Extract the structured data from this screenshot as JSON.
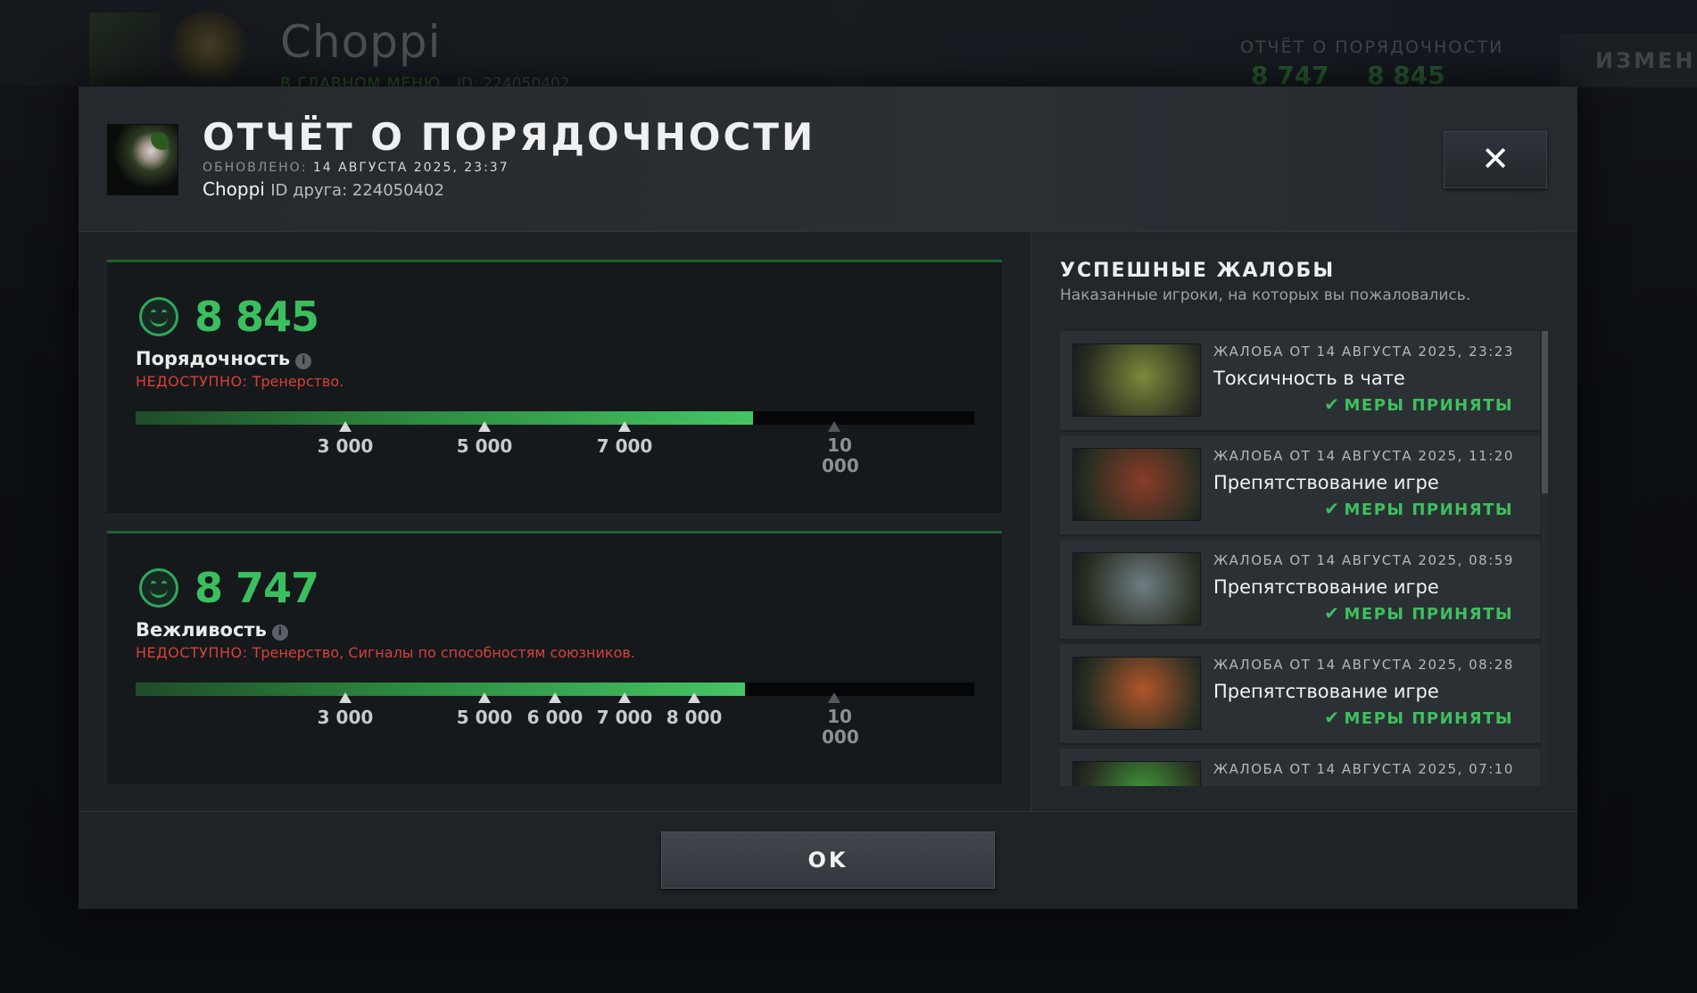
{
  "background": {
    "player_name": "Choppi",
    "status": "В ГЛАВНОМ МЕНЮ",
    "id_label": "ID: 224050402",
    "report_label": "ОТЧЁТ О ПОРЯДОЧНОСТИ",
    "score_1": "8 747",
    "score_2": "8 845",
    "change_button": "ИЗМЕНИ"
  },
  "modal": {
    "title": "ОТЧЁТ О ПОРЯДОЧНОСТИ",
    "updated_label": "ОБНОВЛЕНО:",
    "updated_value": "14 АВГУСТА 2025, 23:37",
    "player_name": "Choppi",
    "friend_id": "ID друга: 224050402",
    "close_label": "✕",
    "ok_label": "OK"
  },
  "conduct": {
    "value": "8 845",
    "label": "Порядочность",
    "unavailable_tag": "НЕДОСТУПНО:",
    "unavailable_text": "Тренерство.",
    "progress_fraction": 0.736,
    "markers": [
      {
        "label": "3 000",
        "pos": 0.25,
        "dim": false
      },
      {
        "label": "5 000",
        "pos": 0.416,
        "dim": false
      },
      {
        "label": "7 000",
        "pos": 0.583,
        "dim": false
      },
      {
        "label": "10 000",
        "pos": 0.833,
        "dim": true
      }
    ]
  },
  "politeness": {
    "value": "8 747",
    "label": "Вежливость",
    "unavailable_tag": "НЕДОСТУПНО:",
    "unavailable_text": "Тренерство, Сигналы по способностям союзников.",
    "progress_fraction": 0.727,
    "markers": [
      {
        "label": "3 000",
        "pos": 0.25,
        "dim": false
      },
      {
        "label": "5 000",
        "pos": 0.416,
        "dim": false
      },
      {
        "label": "6 000",
        "pos": 0.5,
        "dim": false
      },
      {
        "label": "7 000",
        "pos": 0.583,
        "dim": false
      },
      {
        "label": "8 000",
        "pos": 0.666,
        "dim": false
      },
      {
        "label": "10 000",
        "pos": 0.833,
        "dim": true
      }
    ]
  },
  "reports_panel": {
    "title": "УСПЕШНЫЕ ЖАЛОБЫ",
    "subtitle": "Наказанные игроки, на которых вы пожаловались.",
    "status_label": "МЕРЫ ПРИНЯТЫ",
    "items": [
      {
        "date": "ЖАЛОБА ОТ 14 АВГУСТА 2025, 23:23",
        "type": "Токсичность в чате",
        "hero": "pudge",
        "color": "#7c8a3a"
      },
      {
        "date": "ЖАЛОБА ОТ 14 АВГУСТА 2025, 11:20",
        "type": "Препятствование игре",
        "hero": "sand-king",
        "color": "#8a3b28"
      },
      {
        "date": "ЖАЛОБА ОТ 14 АВГУСТА 2025, 08:59",
        "type": "Препятствование игре",
        "hero": "sniper",
        "color": "#6f7c83"
      },
      {
        "date": "ЖАЛОБА ОТ 14 АВГУСТА 2025, 08:28",
        "type": "Препятствование игре",
        "hero": "bounty-hunter",
        "color": "#b0552a"
      },
      {
        "date": "ЖАЛОБА ОТ 14 АВГУСТА 2025, 07:10",
        "type": "",
        "hero": "venomancer",
        "color": "#3f9b3a"
      }
    ]
  },
  "colors": {
    "accent_green": "#3bbf5e",
    "warning_red": "#d6413a"
  }
}
